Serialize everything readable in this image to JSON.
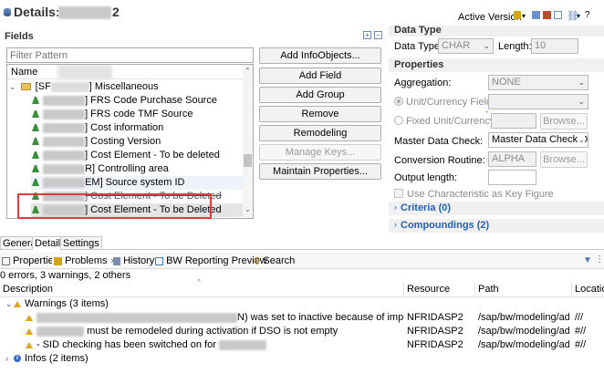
{
  "header": {
    "title_prefix": "Details:",
    "title_suffix": "2",
    "active_version_label": "Active Version"
  },
  "fields_panel": {
    "title": "Fields",
    "filter_placeholder": "Filter Pattern",
    "column_name": "Name",
    "tree_root_label": "] Miscellaneous",
    "tree_root_prefix": "[SF",
    "items": [
      {
        "suffix": "] FRS Code Purchase Source"
      },
      {
        "suffix": "] FRS code TMF Source"
      },
      {
        "suffix": "] Cost information"
      },
      {
        "suffix": "] Costing Version"
      },
      {
        "suffix": "] Cost Element - To be deleted"
      },
      {
        "suffix": "R] Controlling area"
      },
      {
        "suffix": "EM] Source system ID"
      },
      {
        "suffix": "] Cost Element - To be Deleted"
      },
      {
        "suffix": "] Cost Element - To be Deleted"
      }
    ]
  },
  "buttons": {
    "add_infoobjects": "Add InfoObjects...",
    "add_field": "Add Field",
    "add_group": "Add Group",
    "remove": "Remove",
    "remodeling": "Remodeling",
    "manage_keys": "Manage Keys...",
    "maintain_properties": "Maintain Properties..."
  },
  "data_type": {
    "section_title": "Data Type",
    "data_type_label": "Data Type:",
    "data_type_value": "CHAR",
    "length_label": "Length:",
    "length_value": "10"
  },
  "properties": {
    "section_title": "Properties",
    "aggregation_label": "Aggregation:",
    "aggregation_value": "NONE",
    "unit_currency_field_label": "Unit/Currency Field:",
    "fixed_unit_currency_label": "Fixed Unit/Currency:",
    "browse_label": "Browse...",
    "master_data_check_label": "Master Data Check:",
    "master_data_check_value": "Master Data Check D",
    "conversion_routine_label": "Conversion Routine:",
    "conversion_routine_value": "ALPHA",
    "output_length_label": "Output length:",
    "use_characteristic_label": "Use Characteristic as Key Figure",
    "criteria_label": "Criteria (0)",
    "compoundings_label": "Compoundings (2)"
  },
  "editor_tabs": [
    "General",
    "Details",
    "Settings"
  ],
  "bottom_tabs": [
    {
      "label": "Properties",
      "icon": "properties-icon"
    },
    {
      "label": "Problems",
      "icon": "problems-icon",
      "close": "✕"
    },
    {
      "label": "History",
      "icon": "history-icon"
    },
    {
      "label": "BW Reporting Preview",
      "icon": "preview-icon"
    },
    {
      "label": "Search",
      "icon": "search-icon"
    }
  ],
  "problems": {
    "summary": "0 errors, 3 warnings, 2 others",
    "columns": {
      "description": "Description",
      "resource": "Resource",
      "path": "Path",
      "location": "Location"
    },
    "warnings_group": "Warnings (3 items)",
    "warnings": [
      {
        "description_suffix": "N) was set to inactive because of impact analysis",
        "resource": "NFRIDASP2",
        "path": "/sap/bw/modeling/ad...",
        "location": "///"
      },
      {
        "description_suffix": "must be remodeled during activation if DSO is not empty",
        "resource": "NFRIDASP2",
        "path": "/sap/bw/modeling/ad...",
        "location": "#//"
      },
      {
        "description_suffix": "- SID checking has been switched on for",
        "resource": "NFRIDASP2",
        "path": "/sap/bw/modeling/ad...",
        "location": "#//"
      }
    ],
    "infos_group": "Infos (2 items)"
  },
  "colors": {
    "highlight_border": "#e03c3c",
    "link_blue": "#1f5fb4",
    "selected_row": "#e4e4e4"
  }
}
